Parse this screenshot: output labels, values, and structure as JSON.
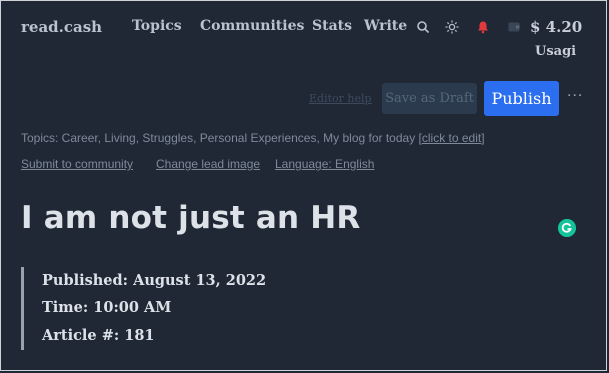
{
  "header": {
    "brand": "read.cash",
    "nav": {
      "topics": "Topics",
      "communities": "Communities",
      "stats": "Stats",
      "write": "Write"
    },
    "icons": [
      "search-icon",
      "sun-icon",
      "bell-icon",
      "wallet-icon"
    ],
    "balance": "$ 4.20",
    "username": "Usagi"
  },
  "toolbar": {
    "editor_help": "Editor help",
    "save_draft_label": "Save as Draft",
    "publish_label": "Publish",
    "more": "···"
  },
  "meta": {
    "topics_prefix": "Topics: Career, Living, Struggles, Personal Experiences, My blog for today [",
    "topics_edit": "click to edit",
    "topics_suffix": "]",
    "submit_community": "Submit to community",
    "change_lead_image": "Change lead image",
    "language": "Language: English"
  },
  "article": {
    "title": "I am not just an HR",
    "quote": {
      "published": "Published: August 13, 2022",
      "time": "Time: 10:00 AM",
      "article_number": "Article #: 181"
    }
  },
  "colors": {
    "background": "#202836",
    "accent": "#2b6ef0",
    "notification": "#e0393e",
    "grammarly": "#15c39a"
  }
}
